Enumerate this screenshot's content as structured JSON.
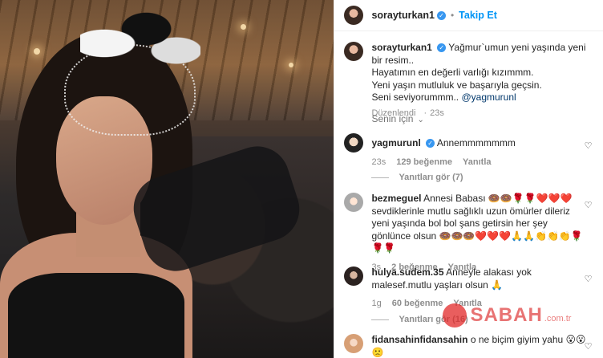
{
  "post_author": {
    "username": "sorayturkan1",
    "follow_label": "Takip Et",
    "separator": "•"
  },
  "caption": {
    "username": "sorayturkan1",
    "text_line1": "Yağmur`umun yeni yaşında yeni bir resim..",
    "text_line2": "Hayatımın en değerli varlığı kızımmm.",
    "text_line3": "Yeni yaşın mutluluk ve başarıyla geçsin.",
    "text_line4_prefix": "Seni seviyorummm.. ",
    "mention": "@yagmurunl",
    "edited_label": "Düzenlendi",
    "time": "23s"
  },
  "filter": {
    "label": "Senin için"
  },
  "comments": [
    {
      "username": "yagmurunl",
      "text": "Annemmmmmmm",
      "time": "23s",
      "likes": "129 beğenme",
      "reply_label": "Yanıtla",
      "view_replies": "Yanıtları gör (7)"
    },
    {
      "username": "bezmeguel",
      "text": "Annesi Babası 🍩🍩🌹🌹❤️❤️❤️ sevdiklerinle mutlu sağlıklı uzun ömürler dileriz yeni yaşında bol bol şans getirsin her şey gönlünce olsun 🍩🍩🍩❤️❤️❤️🙏🙏👏👏👏🌹🌹🌹",
      "time": "3s",
      "likes": "2 beğenme",
      "reply_label": "Yanıtla"
    },
    {
      "username": "hulya.sudem.35",
      "text": "Anneyle alakası yok malesef.mutlu yaşları olsun 🙏",
      "time": "1g",
      "likes": "60 beğenme",
      "reply_label": "Yanıtla",
      "view_replies": "Yanıtları gör (16)"
    },
    {
      "username": "fidansahinfidansahin",
      "text": "o ne biçim giyim yahu 😮😮🙁"
    }
  ],
  "watermark": {
    "brand": "SABAH",
    "suffix": ".com.tr"
  },
  "icons": {
    "verified": "verified-badge-icon",
    "heart": "heart-icon",
    "chevron": "chevron-down-icon"
  },
  "colors": {
    "accent": "#0095f6",
    "verified": "#3897f0",
    "muted": "#8e8e8e",
    "text": "#262626"
  }
}
